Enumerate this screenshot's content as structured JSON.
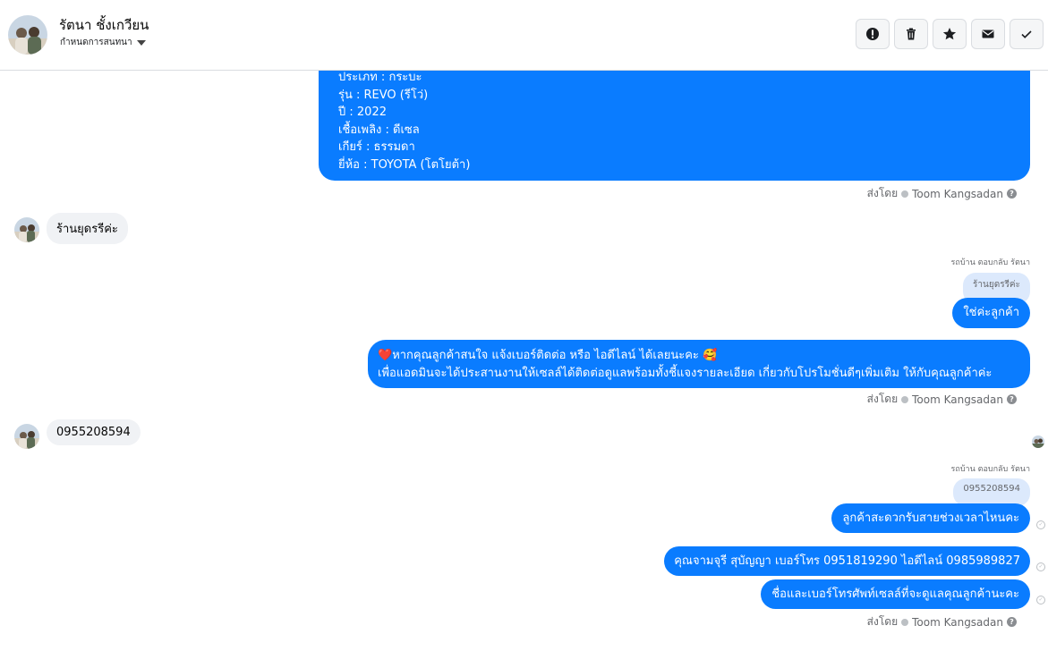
{
  "header": {
    "contact_name": "รัตนา ชั้งเกวียน",
    "settings_label": "กำหนดการสนทนา",
    "actions": [
      "spam-icon",
      "trash-icon",
      "star-icon",
      "mail-icon",
      "check-icon"
    ]
  },
  "messages": {
    "car_details": [
      "ประเภท : กระบะ",
      "รุ่น : REVO (รีโว่)",
      "ปี : 2022",
      "เชื้อเพลิง : ดีเซล",
      "เกียร์ : ธรรมดา",
      "ยี่ห้อ : TOYOTA (โตโยต้า)"
    ],
    "sent_by_prefix": "ส่งโดย",
    "sent_by_name": "Toom Kangsadan",
    "incoming_1": "ร้านยุดรรีค่ะ",
    "replying_label_1": "รถบ้าน ตอบกลับ รัตนา",
    "quote_1": "ร้านยุดรรีค่ะ",
    "reply_1": "ใช่ค่ะลูกค้า",
    "promo_heart": "❤️",
    "promo_line_1": "หากคุณลูกค้าสนใจ แจ้งเบอร์ติดต่อ หรือ ไอดีไลน์ ได้เลยนะคะ 🥰",
    "promo_line_2": "เพื่อแอดมินจะได้ประสานงานให้เซลล์ได้ติดต่อดูแลพร้อมทั้งชี้แจงรายละเอียด เกี่ยวกับโปรโมชั่นดีๆเพิ่มเติม ให้กับคุณลูกค้าค่ะ",
    "incoming_2": "0955208594",
    "replying_label_2": "รถบ้าน ตอบกลับ รัตนา",
    "quote_2": "0955208594",
    "reply_2": "ลูกค้าสะดวกรับสายช่วงเวลาไหนคะ",
    "reply_3": "คุณจามจุรี สุบัญญา เบอร์โทร 0951819290  ไอดีไลน์ 0985989827",
    "reply_4": "ชื่อและเบอร์โทรศัพท์เซลล์ที่จะดูแลคุณลูกค้านะคะ",
    "help_glyph": "?",
    "check_glyph": "✓"
  }
}
